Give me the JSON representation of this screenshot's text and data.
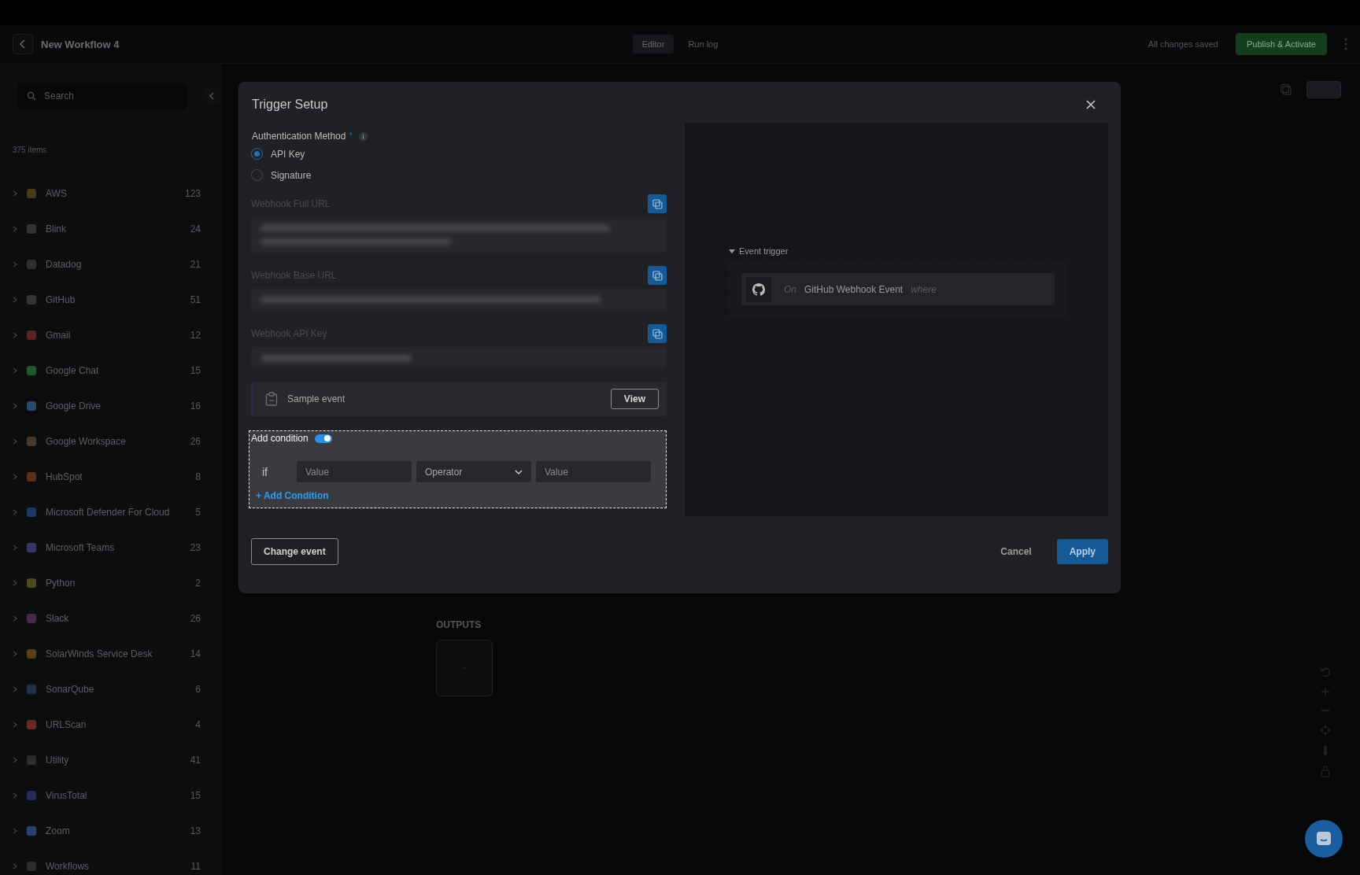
{
  "header": {
    "title": "New Workflow 4",
    "tabs": [
      {
        "label": "Editor",
        "selected": true
      },
      {
        "label": "Run log",
        "selected": false
      }
    ],
    "save_status": "All changes saved",
    "publish_button": "Publish & Activate"
  },
  "sidebar": {
    "search": {
      "placeholder": "Search"
    },
    "count": "375 items",
    "items": [
      {
        "name": "AWS",
        "count": "123",
        "color": "#4a3718"
      },
      {
        "name": "Blink",
        "count": "24",
        "color": "#333333"
      },
      {
        "name": "Datadog",
        "count": "21",
        "color": "#303030"
      },
      {
        "name": "GitHub",
        "count": "51",
        "color": "#343434"
      },
      {
        "name": "Gmail",
        "count": "12",
        "color": "#5a2222"
      },
      {
        "name": "Google Chat",
        "count": "15",
        "color": "#1f5a2a"
      },
      {
        "name": "Google Drive",
        "count": "16",
        "color": "#2a4a6a"
      },
      {
        "name": "Google Workspace",
        "count": "26",
        "color": "#4a3a2a"
      },
      {
        "name": "HubSpot",
        "count": "8",
        "color": "#5a2e18"
      },
      {
        "name": "Microsoft Defender For Cloud",
        "count": "5",
        "color": "#1f3a66"
      },
      {
        "name": "Microsoft Teams",
        "count": "23",
        "color": "#34366a"
      },
      {
        "name": "Python",
        "count": "2",
        "color": "#4a4a22"
      },
      {
        "name": "Slack",
        "count": "26",
        "color": "#4a2a4a"
      },
      {
        "name": "SolarWinds Service Desk",
        "count": "14",
        "color": "#5a4018"
      },
      {
        "name": "SonarQube",
        "count": "6",
        "color": "#22304a"
      },
      {
        "name": "URLScan",
        "count": "4",
        "color": "#6a2a22"
      },
      {
        "name": "Utility",
        "count": "41",
        "color": "#2e2e2e"
      },
      {
        "name": "VirusTotal",
        "count": "15",
        "color": "#252a5a"
      },
      {
        "name": "Zoom",
        "count": "13",
        "color": "#2a4070"
      },
      {
        "name": "Workflows",
        "count": "11",
        "color": "#2c2c2c"
      }
    ]
  },
  "canvas": {
    "outputs_label": "OUTPUTS"
  },
  "dialog": {
    "title": "Trigger Setup",
    "auth": {
      "label": "Authentication Method",
      "required_mark": "*",
      "options": [
        {
          "label": "API Key",
          "selected": true
        },
        {
          "label": "Signature",
          "selected": false
        }
      ]
    },
    "fields": [
      {
        "label": "Webhook Full URL",
        "kind": "blurred-multiline"
      },
      {
        "label": "Webhook Base URL",
        "kind": "blurred-line"
      },
      {
        "label": "Webhook API Key",
        "kind": "blurred-short"
      }
    ],
    "sample_event": {
      "label": "Sample event",
      "button": "View"
    },
    "condition": {
      "label": "Add condition",
      "on": true,
      "if_label": "if",
      "inputs": [
        {
          "placeholder": "Value",
          "kind": "text"
        },
        {
          "placeholder": "Operator",
          "kind": "select"
        },
        {
          "placeholder": "Value",
          "kind": "text"
        }
      ],
      "add_link": "+ Add Condition"
    },
    "preview": {
      "section": "Event trigger",
      "on_word": "On",
      "event": "GitHub Webhook Event",
      "where_word": "where"
    },
    "buttons": {
      "change": "Change event",
      "cancel": "Cancel",
      "apply": "Apply"
    }
  }
}
